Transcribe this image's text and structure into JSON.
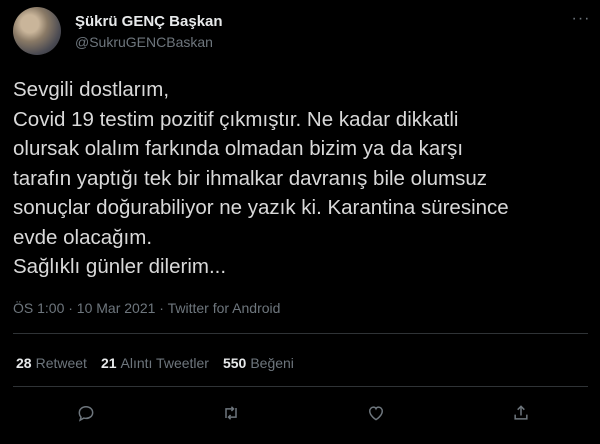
{
  "tweet": {
    "author_name": "Şükrü GENÇ Başkan",
    "handle": "@SukruGENCBaskan",
    "more_glyph": "···",
    "lines": [
      "Sevgili dostlarım,",
      "Covid 19 testim pozitif çıkmıştır. Ne kadar dikkatli",
      "olursak olalım farkında olmadan bizim ya da karşı",
      "tarafın yaptığı tek bir ihmalkar davranış bile olumsuz",
      "sonuçlar doğurabiliyor ne yazık ki. Karantina süresince",
      "evde olacağım.",
      "Sağlıklı günler dilerim..."
    ],
    "meta": "ÖS 1:00 · 10 Mar 2021 · Twitter for Android",
    "stats": {
      "retweets_count": "28",
      "retweets_label": "Retweet",
      "quotes_count": "21",
      "quotes_label": "Alıntı Tweetler",
      "likes_count": "550",
      "likes_label": "Beğeni"
    },
    "actions": [
      "reply-icon",
      "retweet-icon",
      "like-icon",
      "share-icon"
    ]
  }
}
